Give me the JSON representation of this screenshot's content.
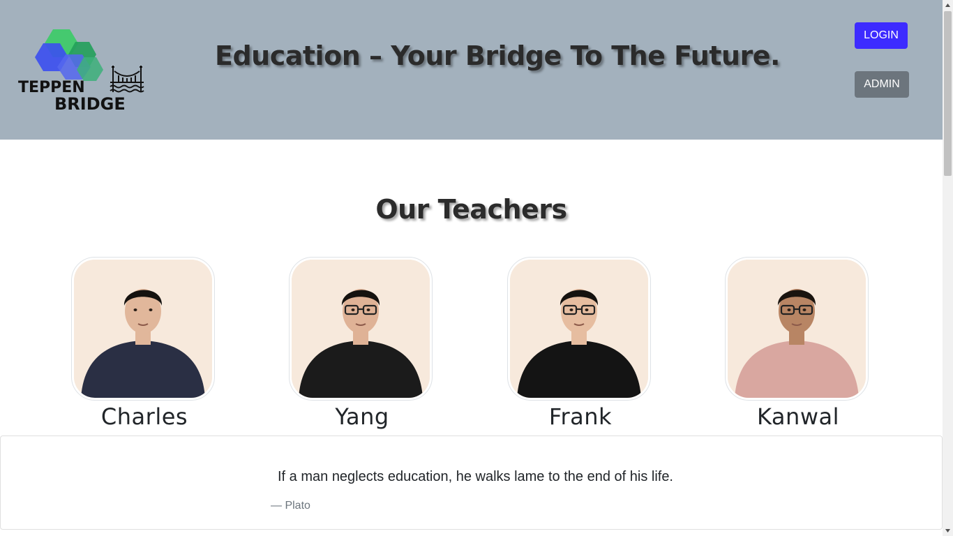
{
  "header": {
    "logo_text_line1": "TEPPEN",
    "logo_text_line2": "BRIDGE",
    "headline": "Education – Your Bridge To The Future.",
    "login_label": "LOGIN",
    "admin_label": "ADMIN"
  },
  "section": {
    "title": "Our Teachers"
  },
  "teachers": [
    {
      "name": "Charles",
      "shirt": "#2a2f44",
      "skin": "#e1b79b",
      "hair": "#15120f",
      "glasses": false
    },
    {
      "name": "Yang",
      "shirt": "#1b1b1b",
      "skin": "#dfb296",
      "hair": "#15120f",
      "glasses": true
    },
    {
      "name": "Frank",
      "shirt": "#141414",
      "skin": "#e6bda0",
      "hair": "#15120f",
      "glasses": true
    },
    {
      "name": "Kanwal",
      "shirt": "#d9a7a0",
      "skin": "#b88564",
      "hair": "#1a140f",
      "glasses": true
    }
  ],
  "quote": {
    "text": "If a man neglects education, he walks lame to the end of his life.",
    "author": "— Plato"
  },
  "colors": {
    "header_bg": "#a3b1bd",
    "login_btn": "#3d2bff",
    "admin_btn": "#6c757d"
  }
}
